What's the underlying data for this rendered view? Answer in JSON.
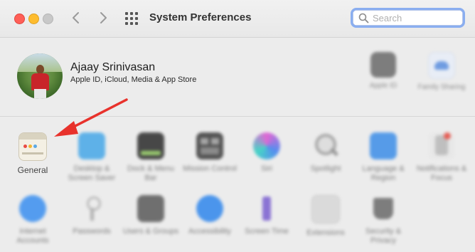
{
  "window": {
    "title": "System Preferences"
  },
  "search": {
    "placeholder": "Search"
  },
  "profile": {
    "name": "Ajaay Srinivasan",
    "subtitle": "Apple ID, iCloud, Media & App Store",
    "shortcuts": [
      {
        "label": "Apple ID",
        "icon": "apple-id-icon"
      },
      {
        "label": "Family Sharing",
        "icon": "family-sharing-icon"
      }
    ]
  },
  "panes": [
    {
      "label": "General",
      "icon": "general-icon",
      "focus": true
    },
    {
      "label": "Desktop & Screen Saver",
      "icon": "desktop-icon"
    },
    {
      "label": "Dock & Menu Bar",
      "icon": "dock-icon"
    },
    {
      "label": "Mission Control",
      "icon": "mission-control-icon"
    },
    {
      "label": "Siri",
      "icon": "siri-icon"
    },
    {
      "label": "Spotlight",
      "icon": "spotlight-icon"
    },
    {
      "label": "Language & Region",
      "icon": "language-icon"
    },
    {
      "label": "Notifications & Focus",
      "icon": "notifications-icon"
    },
    {
      "label": "Internet Accounts",
      "icon": "internet-accounts-icon"
    },
    {
      "label": "Passwords",
      "icon": "passwords-icon"
    },
    {
      "label": "Users & Groups",
      "icon": "users-icon"
    },
    {
      "label": "Accessibility",
      "icon": "accessibility-icon"
    },
    {
      "label": "Screen Time",
      "icon": "screen-time-icon"
    },
    {
      "label": "Extensions",
      "icon": "extensions-icon"
    },
    {
      "label": "Security & Privacy",
      "icon": "security-icon"
    }
  ],
  "colors": {
    "accent": "#8aaef0",
    "annotation_arrow": "#e8322c"
  }
}
